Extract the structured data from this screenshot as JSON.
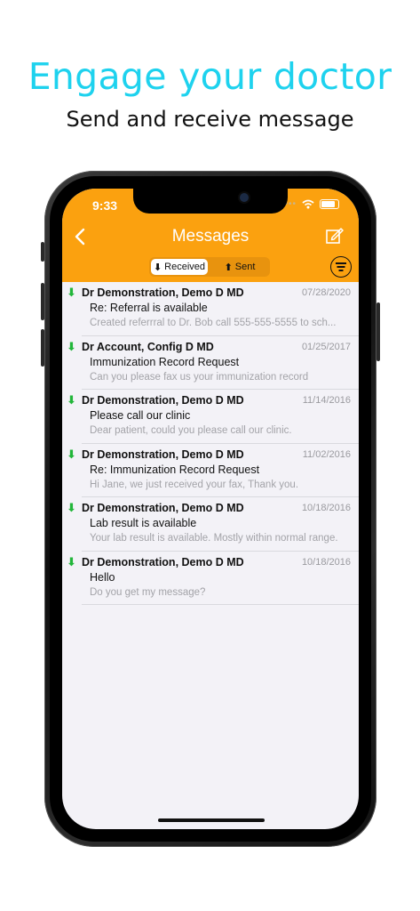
{
  "promo": {
    "headline": "Engage your doctor",
    "subheadline": "Send and receive message"
  },
  "status_bar": {
    "time": "9:33"
  },
  "nav": {
    "title": "Messages",
    "back_icon": "chevron-left-icon",
    "compose_icon": "compose-icon",
    "filter_icon": "filter-icon"
  },
  "segment": {
    "received_label": "Received",
    "sent_label": "Sent",
    "selected": "Received"
  },
  "messages": [
    {
      "sender": "Dr Demonstration, Demo D MD",
      "date": "07/28/2020",
      "subject": "Re: Referral is available",
      "preview": "Created referrral to Dr. Bob call 555-555-5555 to sch..."
    },
    {
      "sender": "Dr Account, Config D MD",
      "date": "01/25/2017",
      "subject": "Immunization Record Request",
      "preview": "Can you please fax us your immunization record"
    },
    {
      "sender": "Dr Demonstration, Demo D MD",
      "date": "11/14/2016",
      "subject": "Please call our clinic",
      "preview": "Dear patient, could you please call our clinic."
    },
    {
      "sender": "Dr Demonstration, Demo D MD",
      "date": "11/02/2016",
      "subject": "Re: Immunization Record Request",
      "preview": "Hi Jane, we just received your fax, Thank you."
    },
    {
      "sender": "Dr Demonstration, Demo D MD",
      "date": "10/18/2016",
      "subject": "Lab result is available",
      "preview": "Your lab result is available. Mostly within normal range."
    },
    {
      "sender": "Dr Demonstration, Demo D MD",
      "date": "10/18/2016",
      "subject": "Hello",
      "preview": "Do you get my message?"
    }
  ],
  "colors": {
    "headline": "#1ed2ee",
    "navbar": "#fba10f",
    "received_arrow": "#22b63a",
    "background": "#f3f2f7"
  }
}
